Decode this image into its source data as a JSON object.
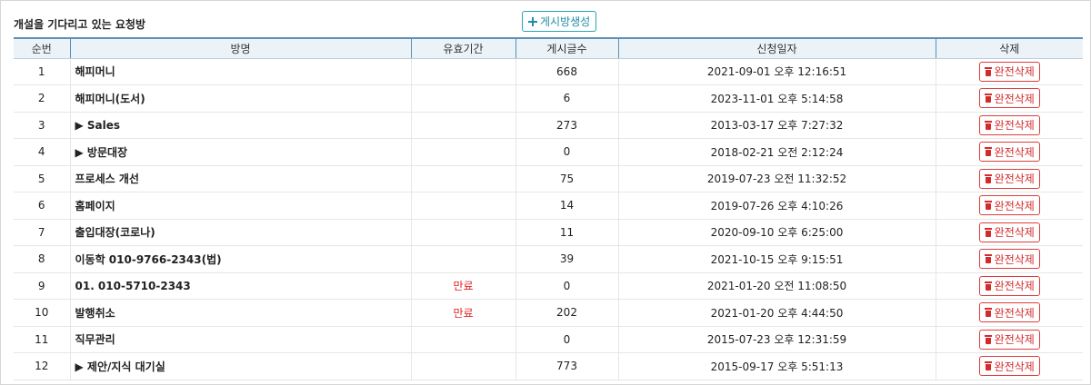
{
  "page": {
    "title": "개설을 기다리고 있는 요청방",
    "create_button": "게시방생성"
  },
  "table": {
    "columns": [
      "순번",
      "방명",
      "유효기간",
      "게시글수",
      "신청일자",
      "삭제"
    ],
    "delete_label": "완전삭제",
    "rows": [
      {
        "no": "1",
        "name": "해피머니",
        "validity": "",
        "posts": "668",
        "date": "2021-09-01 오후 12:16:51"
      },
      {
        "no": "2",
        "name": "해피머니(도서)",
        "validity": "",
        "posts": "6",
        "date": "2023-11-01 오후 5:14:58"
      },
      {
        "no": "3",
        "name": "▶ Sales",
        "validity": "",
        "posts": "273",
        "date": "2013-03-17 오후 7:27:32"
      },
      {
        "no": "4",
        "name": "▶ 방문대장",
        "validity": "",
        "posts": "0",
        "date": "2018-02-21 오전 2:12:24"
      },
      {
        "no": "5",
        "name": "프로세스 개선",
        "validity": "",
        "posts": "75",
        "date": "2019-07-23 오전 11:32:52"
      },
      {
        "no": "6",
        "name": "홈페이지",
        "validity": "",
        "posts": "14",
        "date": "2019-07-26 오후 4:10:26"
      },
      {
        "no": "7",
        "name": "출입대장(코로나)",
        "validity": "",
        "posts": "11",
        "date": "2020-09-10 오후 6:25:00"
      },
      {
        "no": "8",
        "name": "이동학 010-9766-2343(법)",
        "validity": "",
        "posts": "39",
        "date": "2021-10-15 오후 9:15:51"
      },
      {
        "no": "9",
        "name": "01. 010-5710-2343",
        "validity": "만료",
        "posts": "0",
        "date": "2021-01-20 오전 11:08:50"
      },
      {
        "no": "10",
        "name": "발행취소",
        "validity": "만료",
        "posts": "202",
        "date": "2021-01-20 오후 4:44:50"
      },
      {
        "no": "11",
        "name": "직무관리",
        "validity": "",
        "posts": "0",
        "date": "2015-07-23 오후 12:31:59"
      },
      {
        "no": "12",
        "name": "▶ 제안/지식 대기실",
        "validity": "",
        "posts": "773",
        "date": "2015-09-17 오후 5:51:13"
      }
    ]
  },
  "icons": {
    "create": "plus-icon",
    "delete": "trash-icon"
  },
  "colors": {
    "accent": "#1f8fa3",
    "header_line": "#5b8fb3",
    "danger": "#d42a2a",
    "expired": "#e02020"
  }
}
